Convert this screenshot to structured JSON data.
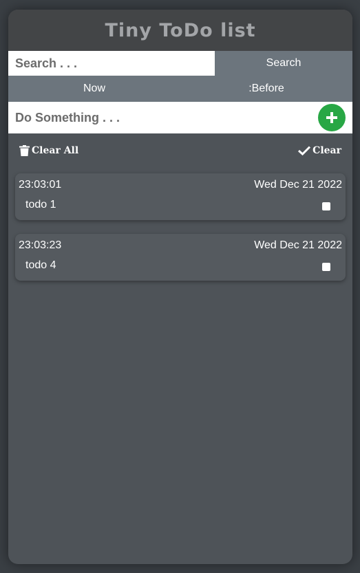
{
  "app": {
    "title": "Tiny ToDo list"
  },
  "search": {
    "placeholder": "Search . . .",
    "value": "",
    "button_label": "Search"
  },
  "filters": [
    {
      "label": "Now"
    },
    {
      "label": ":Before"
    }
  ],
  "add": {
    "placeholder": "Do Something . . .",
    "value": "",
    "button_icon": "plus-icon"
  },
  "actions": {
    "clear_all_label": "Clear All",
    "clear_all_icon": "trash-icon",
    "clear_label": "Clear",
    "clear_icon": "checkmark-icon"
  },
  "todos": [
    {
      "time": "23:03:01",
      "date": "Wed Dec 21 2022",
      "text": "todo 1",
      "checked": false
    },
    {
      "time": "23:03:23",
      "date": "Wed Dec 21 2022",
      "text": "todo 4",
      "checked": false
    }
  ],
  "colors": {
    "accent_green": "#28a745",
    "button_gray": "#6c757d",
    "panel": "#4e5358",
    "title_bar": "#434547"
  }
}
